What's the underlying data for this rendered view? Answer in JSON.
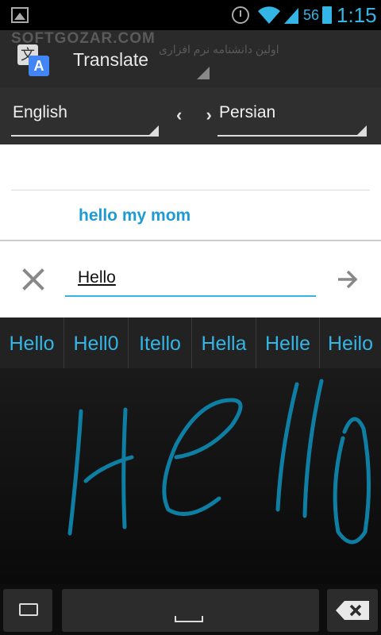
{
  "status_bar": {
    "battery_level": "56",
    "time": "1:15"
  },
  "watermark": {
    "text": "SOFTGOZAR.COM",
    "subtext": "اولین دانشنامه نرم افزاری"
  },
  "action_bar": {
    "title": "Translate"
  },
  "languages": {
    "source": "English",
    "target": "Persian",
    "swap_symbol": "‹ ›"
  },
  "translation": {
    "result": "hello my mom"
  },
  "input": {
    "value": "Hello"
  },
  "suggestions": [
    "Hello",
    "Hell0",
    "Itello",
    "Hella",
    "Helle",
    "Heilo"
  ],
  "colors": {
    "accent": "#33b5e5",
    "ink": "#0e7fa3",
    "result_text": "#1e9bd4"
  }
}
